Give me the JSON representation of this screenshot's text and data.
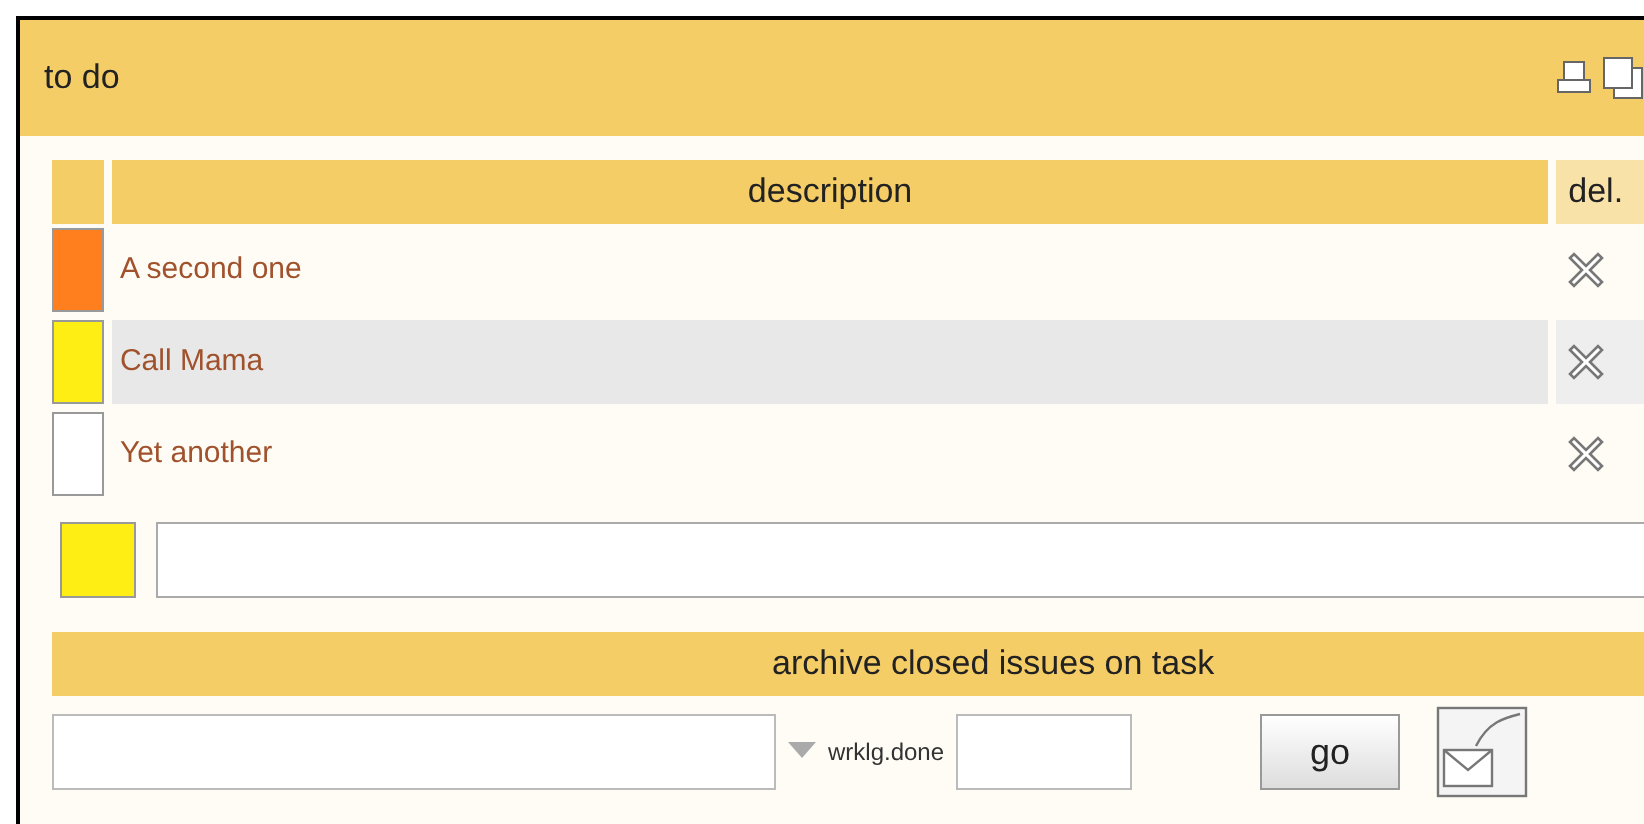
{
  "panel": {
    "title": "to do"
  },
  "table": {
    "columns": [
      "description",
      "del."
    ],
    "rows": [
      {
        "description": "A second one",
        "color": "#ff7f1e",
        "selected": false
      },
      {
        "description": "Call Mama",
        "color": "#ffee14",
        "selected": true
      },
      {
        "description": "Yet another",
        "color": "#ffffff",
        "selected": false
      }
    ]
  },
  "new_item": {
    "color": "#ffee14"
  },
  "archive": {
    "title": "archive closed issues on task",
    "done_label": "wrklg.done",
    "go": "go"
  }
}
